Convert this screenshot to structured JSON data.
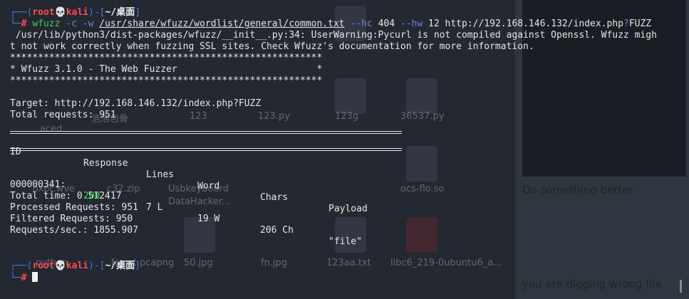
{
  "prompt": {
    "open": "┌──(",
    "user": "root",
    "skull": "💀",
    "host": "kali",
    "mid": ")-[",
    "dir": "~/桌面",
    "close": "]",
    "arrow": "└─",
    "hash": "#"
  },
  "command": {
    "program": "wfuzz",
    "flag_c": "-c",
    "flag_w": "-w",
    "wordlist": "/usr/share/wfuzz/wordlist/general/common.txt",
    "flag_hc": "--hc",
    "hc_value": "404",
    "flag_hw": "--hw",
    "hw_value": "12",
    "url_before": "http://192.168.146.132/index.php",
    "url_q": "?",
    "url_fuzz": "FUZZ"
  },
  "output": {
    "warning_1": " /usr/lib/python3/dist-packages/wfuzz/__init__.py:34: UserWarning:Pycurl is not compiled against Openssl. Wfuzz migh",
    "warning_2": "t not work correctly when fuzzing SSL sites. Check Wfuzz's documentation for more information.",
    "stars": "********************************************************",
    "banner": "* Wfuzz 3.1.0 - The Web Fuzzer                         *",
    "target": "Target: http://192.168.146.132/index.php?FUZZ",
    "total_requests": "Total requests: 951"
  },
  "results_table": {
    "headers": [
      "ID",
      "Response",
      "Lines",
      "Word",
      "Chars",
      "Payload"
    ],
    "rows": [
      {
        "id": "000000341:",
        "response": "200",
        "lines": "7 L",
        "word": "19 W",
        "chars": "206 Ch",
        "payload": "\"file\""
      }
    ]
  },
  "summary": {
    "total_time": "Total time: 0.512417",
    "processed": "Processed Requests: 951",
    "filtered": "Filtered Requests: 950",
    "rate": "Requests/sec.: 1855.907"
  },
  "desktop": {
    "labels": [
      "aced",
      "浩浩包骨",
      "123",
      "123.py",
      "123g",
      "36537.py",
      "oxpt.wve",
      "c32.zip",
      "Usbkeyboard",
      "DataHacker...",
      "ocs-flo.so",
      "python",
      "ferret.pcapng",
      "50.jpg",
      "fn.jpg",
      "123aa.txt",
      "libc6_219-0ubuntu6_a..."
    ],
    "panel_text_1": "Do something better",
    "panel_text_2": "you are digging wrong file"
  }
}
